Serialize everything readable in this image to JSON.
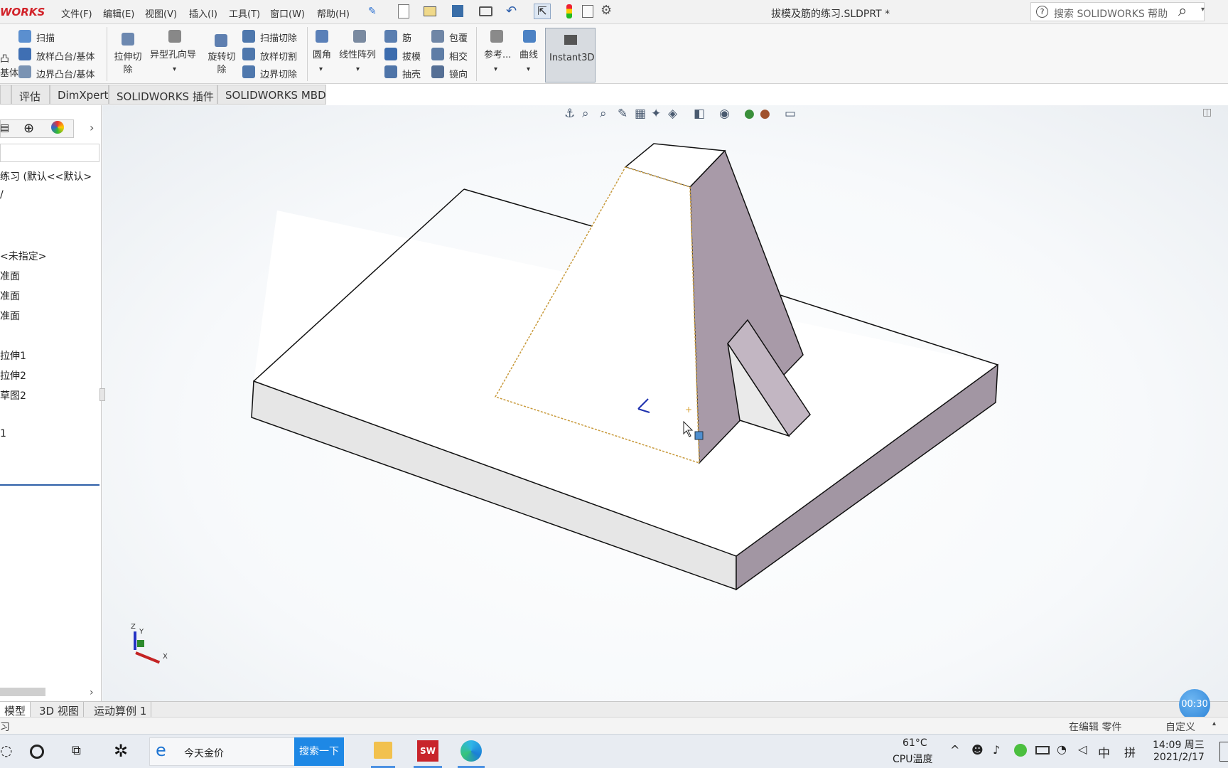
{
  "app": {
    "logo": "WORKS",
    "document_title": "拔模及筋的练习.SLDPRT *"
  },
  "menu": {
    "file": "文件(F)",
    "edit": "编辑(E)",
    "view": "视图(V)",
    "insert": "插入(I)",
    "tools": "工具(T)",
    "window": "窗口(W)",
    "help": "帮助(H)"
  },
  "search": {
    "placeholder": "搜索 SOLIDWORKS 帮助"
  },
  "ribbon": {
    "boss_label_1": "凸",
    "boss_label_2": "基体",
    "sweep": "扫描",
    "loft_boss": "放样凸台/基体",
    "boundary_boss": "边界凸台/基体",
    "extruded_cut": "拉伸切除",
    "hole_wizard": "异型孔向导",
    "revolved_cut": "旋转切除",
    "swept_cut": "扫描切除",
    "lofted_cut": "放样切割",
    "boundary_cut": "边界切除",
    "fillet": "圆角",
    "linear_pattern": "线性阵列",
    "rib": "筋",
    "draft": "拔模",
    "shell": "抽壳",
    "wrap": "包覆",
    "intersect": "相交",
    "mirror": "镜向",
    "reference": "参考...",
    "curves": "曲线",
    "instant3d": "Instant3D"
  },
  "command_tabs": [
    "评估",
    "DimXpert",
    "SOLIDWORKS 插件",
    "SOLIDWORKS MBD"
  ],
  "feature_tree": {
    "root": "练习 (默认<<默认>",
    "items": [
      "<未指定>",
      "准面",
      "准面",
      "准面",
      "拉伸1",
      "拉伸2",
      "草图2",
      "1"
    ]
  },
  "bottom_tabs": [
    "模型",
    "3D 视图",
    "运动算例 1"
  ],
  "status": {
    "left": "习",
    "editing": "在编辑 零件",
    "custom": "自定义"
  },
  "timer": "00:30",
  "triad": {
    "x": "X",
    "y": "Y",
    "z": "Z"
  },
  "taskbar": {
    "news": "今天金价",
    "search_btn": "搜索一下",
    "temp": "61°C",
    "temp_label": "CPU温度",
    "ime_lang": "中",
    "ime_mode": "拼",
    "time": "14:09 周三",
    "date": "2021/2/17"
  },
  "colors": {
    "logo_red": "#d2232a",
    "selection_edge": "#c89a3c",
    "side_face": "#a89aa8",
    "search_btn": "#1e88e5"
  }
}
